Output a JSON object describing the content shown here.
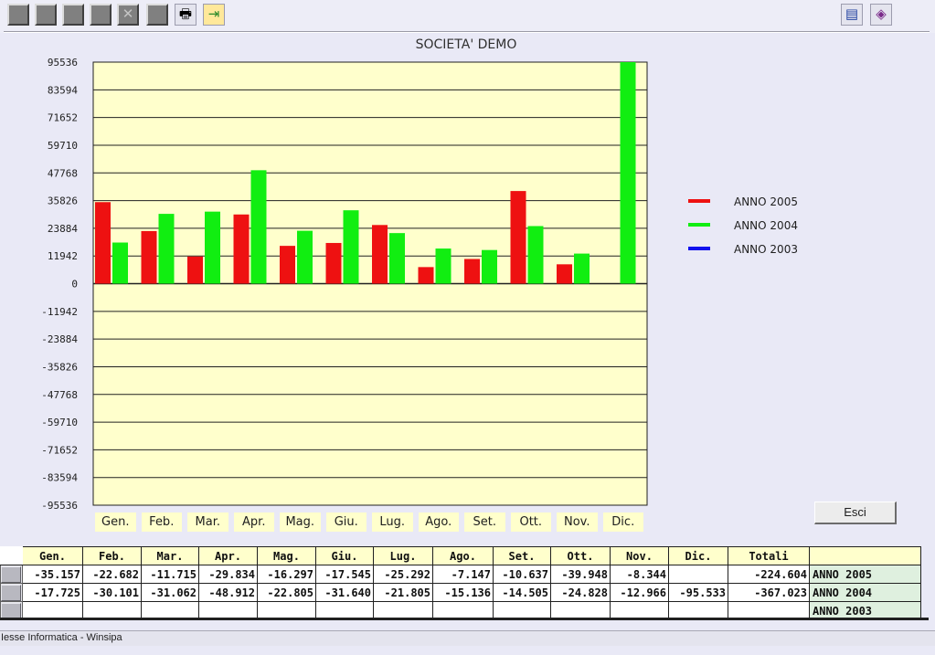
{
  "toolbar": {
    "buttons": [
      {
        "icon": "blank-button"
      },
      {
        "icon": "blank-button"
      },
      {
        "icon": "blank-button"
      },
      {
        "icon": "blank-button"
      },
      {
        "icon": "delete-icon",
        "glyph": "✕"
      },
      {
        "icon": "blank-button"
      }
    ],
    "print_glyph": "🖶",
    "exit_glyph": "⇥",
    "calendar_glyph": "▤",
    "help_glyph": "◈"
  },
  "chart_data": {
    "type": "bar",
    "title": "SOCIETA' DEMO",
    "categories": [
      "Gen.",
      "Feb.",
      "Mar.",
      "Apr.",
      "Mag.",
      "Giu.",
      "Lug.",
      "Ago.",
      "Set.",
      "Ott.",
      "Nov.",
      "Dic."
    ],
    "yticks": [
      "95536",
      "83594",
      "71652",
      "59710",
      "47768",
      "35826",
      "23884",
      "11942",
      "0",
      "-11942",
      "-23884",
      "-35826",
      "-47768",
      "-59710",
      "-71652",
      "-83594",
      "-95536"
    ],
    "ylim": [
      -95536,
      95536
    ],
    "series": [
      {
        "name": "ANNO 2005",
        "color": "#ee1111",
        "values": [
          35157,
          22682,
          11715,
          29834,
          16297,
          17545,
          25292,
          7147,
          10637,
          39948,
          8344,
          null
        ]
      },
      {
        "name": "ANNO 2004",
        "color": "#11ee11",
        "values": [
          17725,
          30101,
          31062,
          48912,
          22805,
          31640,
          21805,
          15136,
          14505,
          24828,
          12966,
          95533
        ]
      },
      {
        "name": "ANNO 2003",
        "color": "#1111ee",
        "values": [
          null,
          null,
          null,
          null,
          null,
          null,
          null,
          null,
          null,
          null,
          null,
          null
        ]
      }
    ],
    "plot_bg": "#ffffcc",
    "grid": true,
    "legend": "right"
  },
  "esci_label": "Esci",
  "table": {
    "headers": [
      "Gen.",
      "Feb.",
      "Mar.",
      "Apr.",
      "Mag.",
      "Giu.",
      "Lug.",
      "Ago.",
      "Set.",
      "Ott.",
      "Nov.",
      "Dic.",
      "Totali"
    ],
    "rows": [
      {
        "cells": [
          "-35.157",
          "-22.682",
          "-11.715",
          "-29.834",
          "-16.297",
          "-17.545",
          "-25.292",
          "-7.147",
          "-10.637",
          "-39.948",
          "-8.344",
          "",
          "-224.604"
        ],
        "year": "ANNO 2005"
      },
      {
        "cells": [
          "-17.725",
          "-30.101",
          "-31.062",
          "-48.912",
          "-22.805",
          "-31.640",
          "-21.805",
          "-15.136",
          "-14.505",
          "-24.828",
          "-12.966",
          "-95.533",
          "-367.023"
        ],
        "year": "ANNO 2004"
      },
      {
        "cells": [
          "",
          "",
          "",
          "",
          "",
          "",
          "",
          "",
          "",
          "",
          "",
          "",
          ""
        ],
        "year": "ANNO 2003"
      }
    ]
  },
  "status_text": "Iesse Informatica - Winsipa"
}
